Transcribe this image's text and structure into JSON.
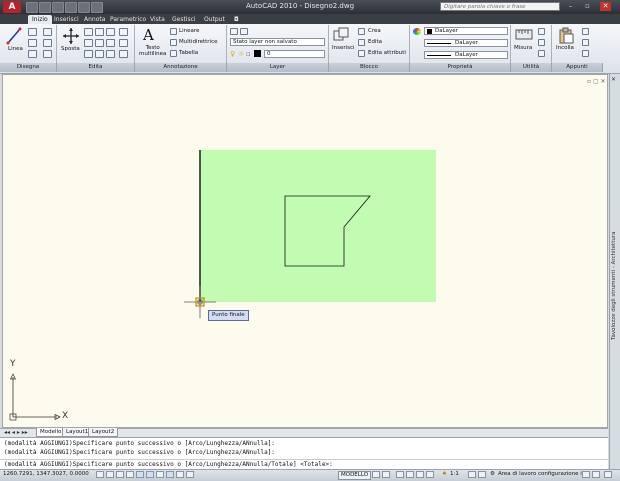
{
  "titlebar": {
    "app_title": "AutoCAD 2010  -  Disegno2.dwg",
    "search_placeholder": "Digitare parola chiave o frase",
    "logo_letter": "A"
  },
  "tabs": [
    "Inizio",
    "Inserisci",
    "Annota",
    "Parametrico",
    "Vista",
    "Gestisci",
    "Output"
  ],
  "ribbon": {
    "draw": {
      "title": "Disegna",
      "line_label": "Linea"
    },
    "modify": {
      "title": "Edita",
      "move_label": "Sposta"
    },
    "annotation": {
      "title": "Annotazione",
      "text_label": "Testo\nmultilinea",
      "linear_label": "Lineare",
      "mleader_label": "Multidirettrice",
      "table_label": "Tabella"
    },
    "layers": {
      "title": "Layer",
      "state_label": "Stato layer non salvato",
      "current_layer": "0"
    },
    "block": {
      "title": "Blocco",
      "insert_label": "Inserisci",
      "create_label": "Crea",
      "edit_label": "Edita",
      "edit_attr_label": "Edita attributi"
    },
    "properties": {
      "title": "Proprietà",
      "color": "DaLayer",
      "linetype": "DaLayer",
      "lineweight": "DaLayer"
    },
    "utilities": {
      "title": "Utilità",
      "measure_label": "Misura"
    },
    "clipboard": {
      "title": "Appunti",
      "paste_label": "Incolla"
    }
  },
  "canvas": {
    "background": "#fdfbee",
    "rect_fill": "#c2fcb3",
    "tooltip": "Punto finale",
    "ucs_x": "X",
    "ucs_y": "Y"
  },
  "palette_label": "Tavolozze degli strumenti - Architettura",
  "layout_tabs": [
    "Modello",
    "Layout1",
    "Layout2"
  ],
  "command": {
    "history": [
      "(modalità AGGIUNGI)Specificare punto successivo o [Arco/Lunghezza/ANnulla]:",
      "(modalità AGGIUNGI)Specificare punto successivo o [Arco/Lunghezza/ANnulla]:"
    ],
    "current": "(modalità AGGIUNGI)Specificare punto successivo o [Arco/Lunghezza/ANnulla/Totale] <Totale>:"
  },
  "status": {
    "coords": "1260.7291, 1347.3027, 0.0000",
    "model_label": "MODELLO",
    "scale_label": "1:1",
    "workspace_label": "Area di lavoro configurazione iniz"
  }
}
